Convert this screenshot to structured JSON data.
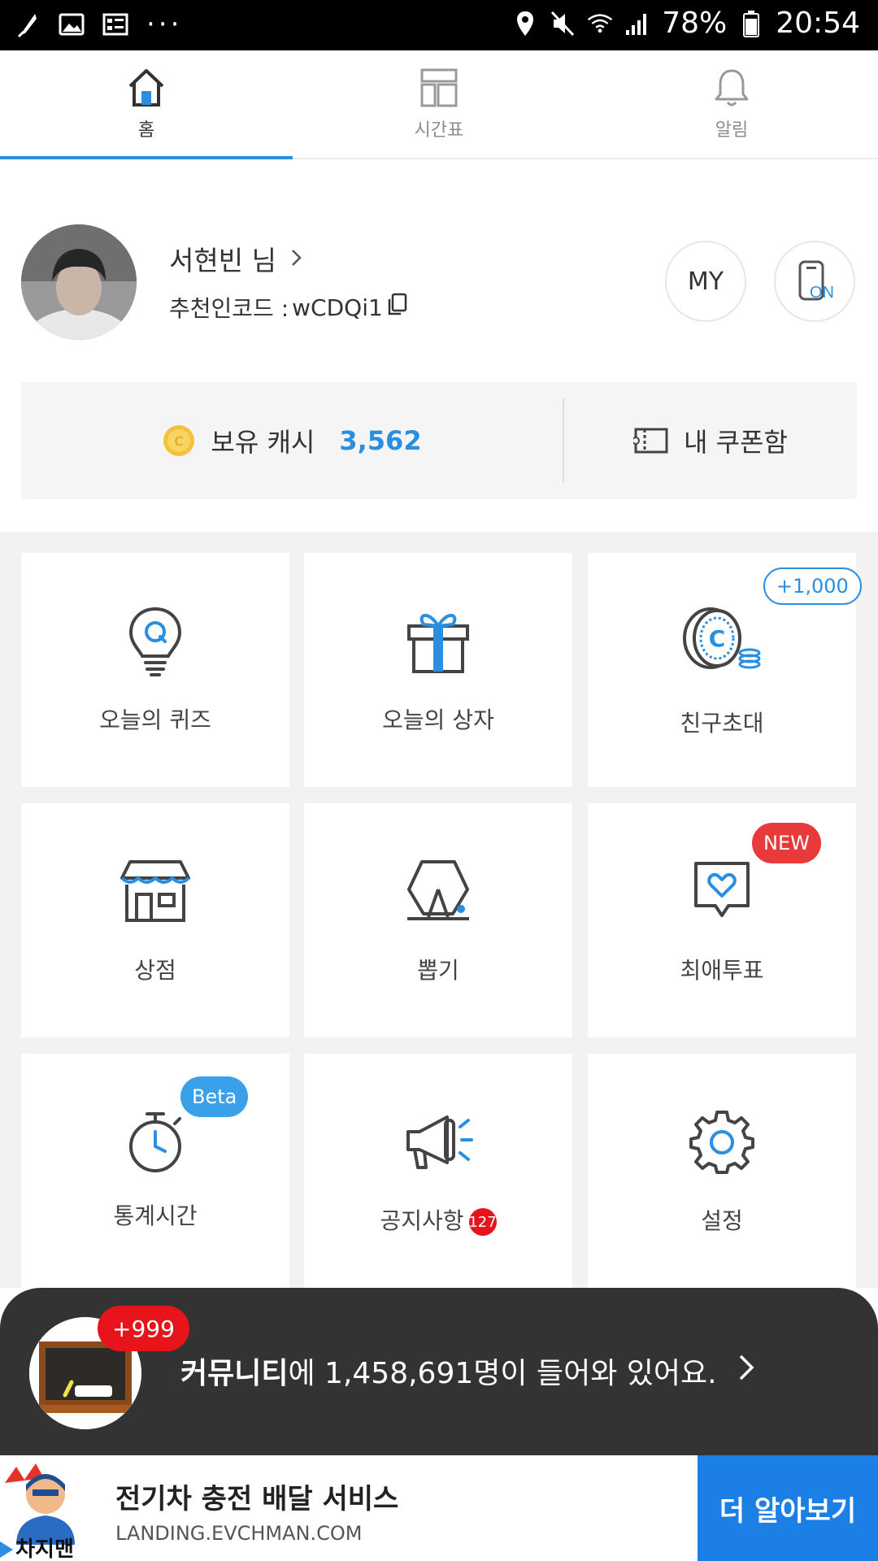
{
  "statusbar": {
    "battery": "78%",
    "time": "20:54",
    "dots": "···"
  },
  "tabs": [
    {
      "label": "홈",
      "icon": "home-icon",
      "active": true
    },
    {
      "label": "시간표",
      "icon": "timetable-icon",
      "active": false
    },
    {
      "label": "알림",
      "icon": "bell-icon",
      "active": false
    }
  ],
  "profile": {
    "name": "서현빈 님",
    "referral_label": "추천인코드 : ",
    "referral_code": "wCDQi1",
    "my_button": "MY",
    "on_button": "ON"
  },
  "cash": {
    "label": "보유 캐시",
    "value": "3,562",
    "coin_letter": "C",
    "coupon_label": "내 쿠폰함"
  },
  "menu": [
    {
      "label": "오늘의 퀴즈",
      "icon": "quiz-bulb-icon"
    },
    {
      "label": "오늘의 상자",
      "icon": "gift-box-icon"
    },
    {
      "label": "친구초대",
      "icon": "coin-icon",
      "badge": "+1,000"
    },
    {
      "label": "상점",
      "icon": "store-icon"
    },
    {
      "label": "뽑기",
      "icon": "draw-icon"
    },
    {
      "label": "최애투표",
      "icon": "heart-vote-icon",
      "badge": "NEW"
    },
    {
      "label": "통계시간",
      "icon": "stopwatch-icon",
      "badge": "Beta"
    },
    {
      "label": "공지사항",
      "icon": "megaphone-icon",
      "count": "127"
    },
    {
      "label": "설정",
      "icon": "gear-icon"
    }
  ],
  "community": {
    "badge": "+999",
    "title_strong": "커뮤니티",
    "title_rest": "에 1,458,691명이 들어와 있어요.",
    "arrow": "〉"
  },
  "ad": {
    "logo_text": "차지맨",
    "title": "전기차 충전 배달 서비스",
    "url": "LANDING.EVCHMAN.COM",
    "button": "더 알아보기"
  },
  "colors": {
    "accent": "#2a8fe0",
    "red": "#e83a3a",
    "dark": "#333333",
    "ad_button": "#1b7fe6"
  }
}
